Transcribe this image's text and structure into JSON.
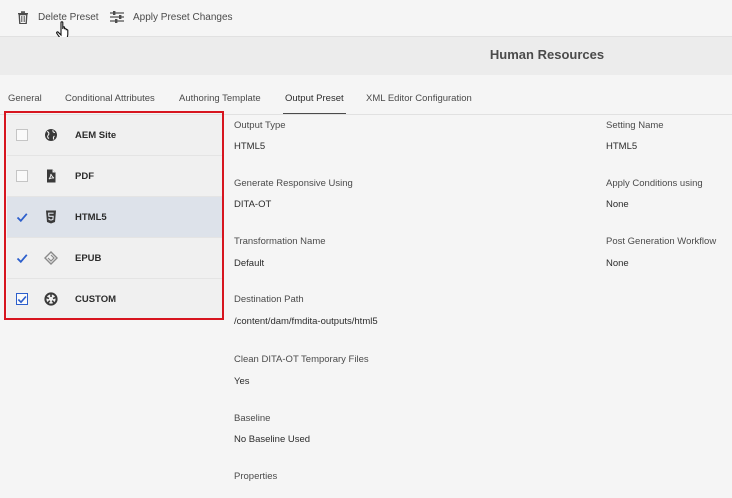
{
  "toolbar": {
    "delete_label": "Delete Preset",
    "apply_label": "Apply Preset Changes"
  },
  "header": {
    "title": "Human Resources"
  },
  "tabs": [
    {
      "label": "General",
      "active": false
    },
    {
      "label": "Conditional Attributes",
      "active": false
    },
    {
      "label": "Authoring Template",
      "active": false
    },
    {
      "label": "Output Preset",
      "active": true
    },
    {
      "label": "XML Editor Configuration",
      "active": false
    }
  ],
  "presets": [
    {
      "label": "AEM Site",
      "icon": "globe-icon",
      "checked": false,
      "selected": false
    },
    {
      "label": "PDF",
      "icon": "pdf-file-icon",
      "checked": false,
      "selected": false
    },
    {
      "label": "HTML5",
      "icon": "html5-icon",
      "checked": true,
      "selected": true
    },
    {
      "label": "EPUB",
      "icon": "epub-icon",
      "checked": true,
      "selected": false
    },
    {
      "label": "CUSTOM",
      "icon": "custom-aperture-icon",
      "checked": true,
      "selected": false
    }
  ],
  "details": {
    "output_type_label": "Output Type",
    "output_type_value": "HTML5",
    "setting_name_label": "Setting Name",
    "setting_name_value": "HTML5",
    "generate_responsive_label": "Generate Responsive Using",
    "generate_responsive_value": "DITA-OT",
    "apply_conditions_label": "Apply Conditions using",
    "apply_conditions_value": "None",
    "transformation_name_label": "Transformation Name",
    "transformation_name_value": "Default",
    "post_generation_label": "Post Generation Workflow",
    "post_generation_value": "None",
    "destination_path_label": "Destination Path",
    "destination_path_value": "/content/dam/fmdita-outputs/html5",
    "clean_temp_label": "Clean DITA-OT Temporary Files",
    "clean_temp_value": "Yes",
    "baseline_label": "Baseline",
    "baseline_value": "No Baseline Used",
    "properties_label": "Properties"
  },
  "colors": {
    "highlight": "#d7151f",
    "checkbox_accent": "#2d5fcc",
    "selected_row": "#dde2ea"
  }
}
